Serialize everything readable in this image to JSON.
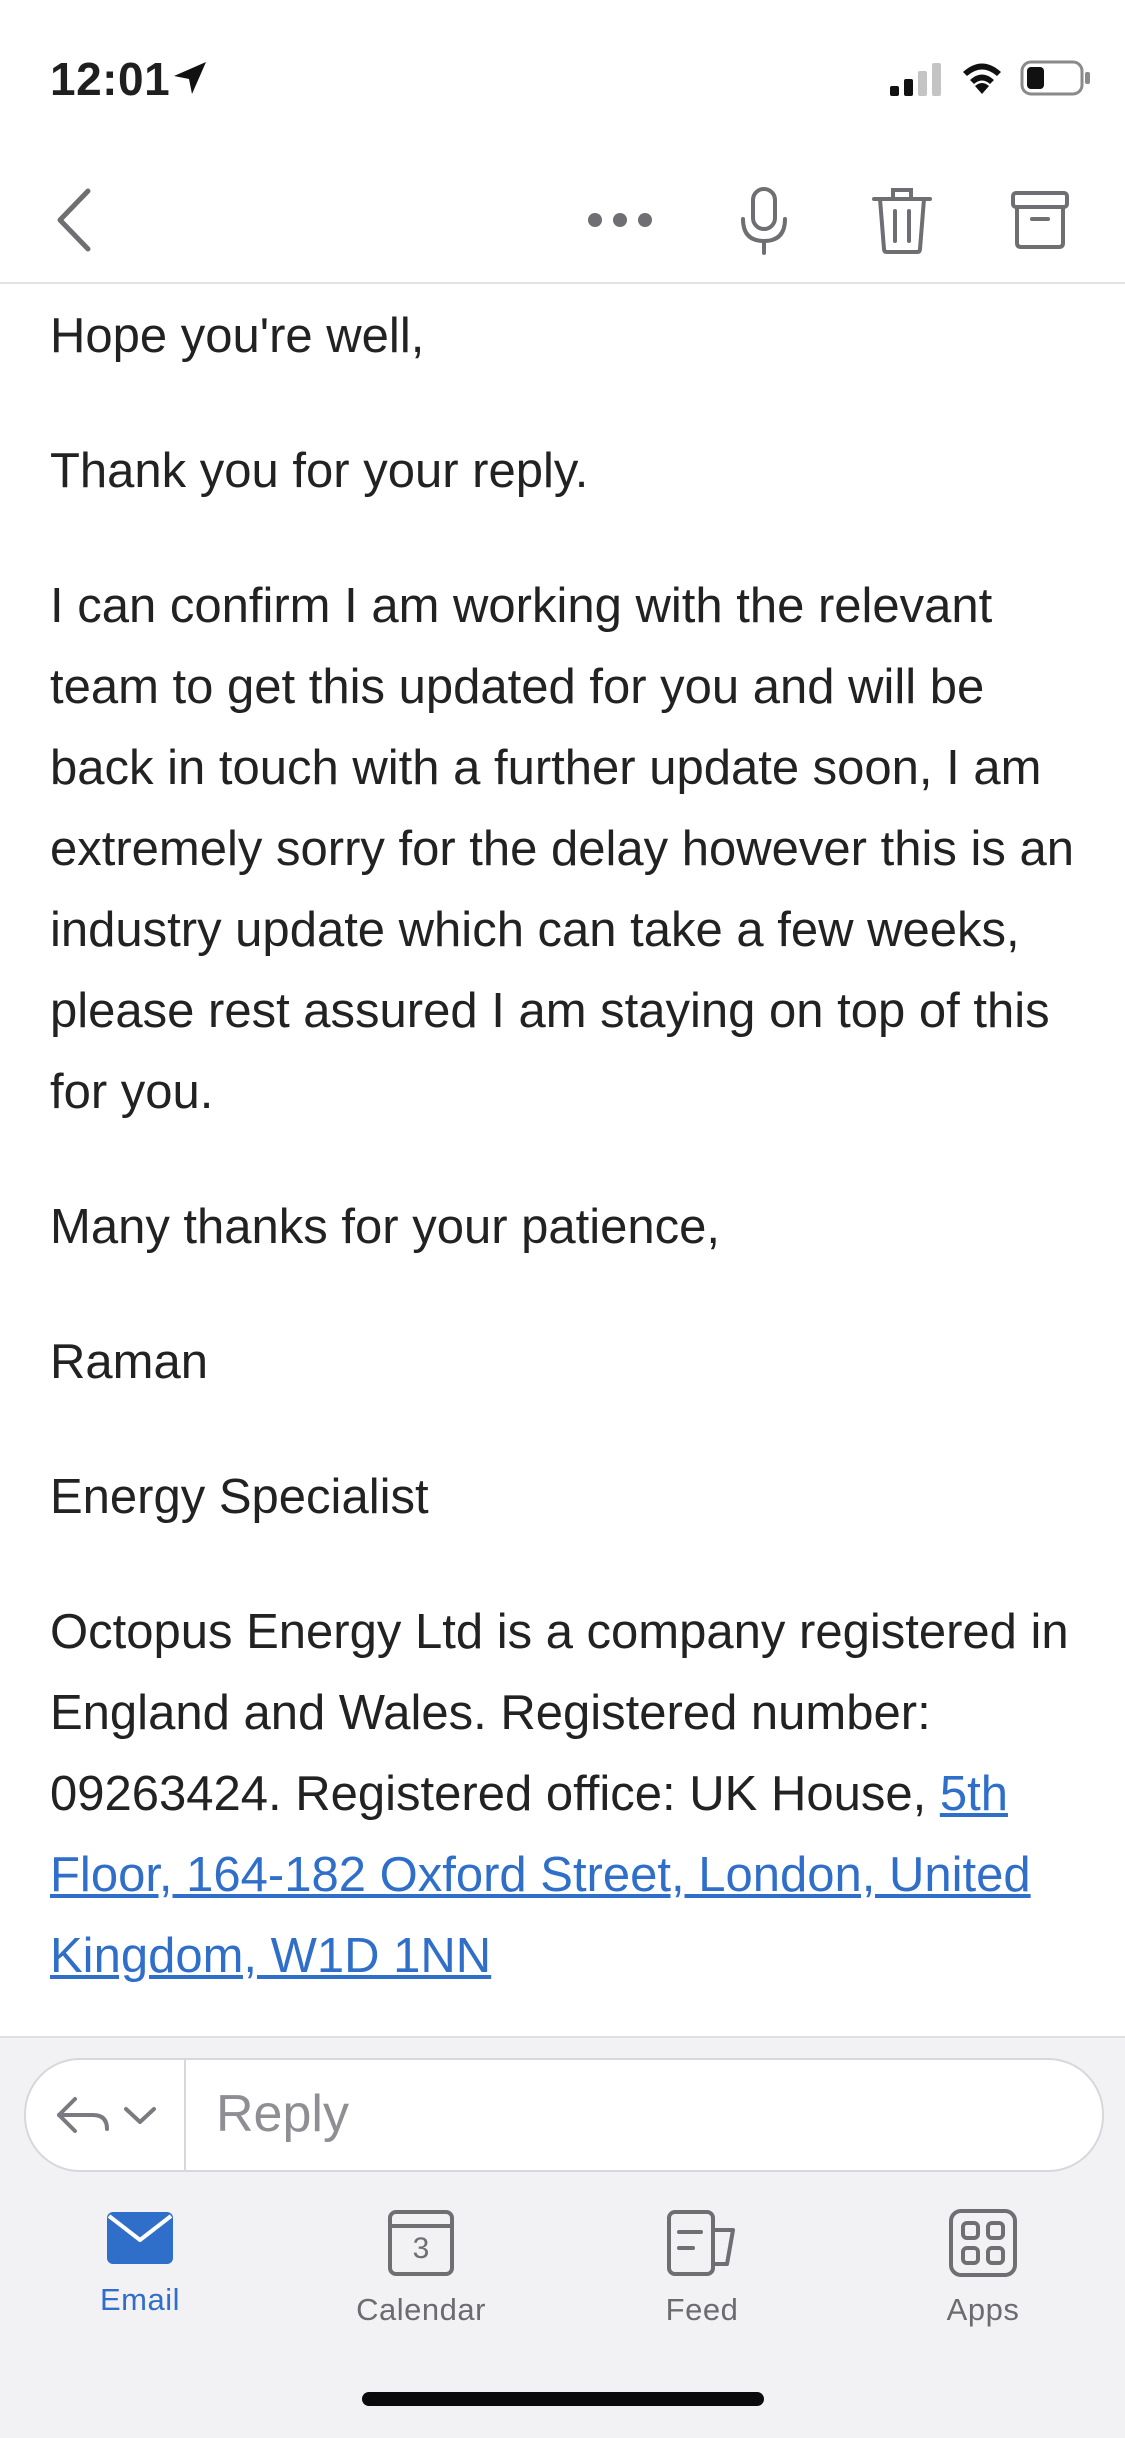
{
  "status_bar": {
    "time": "12:01"
  },
  "toolbar": {
    "icons": [
      "back-chevron-icon",
      "more-icon",
      "microphone-icon",
      "trash-icon",
      "archive-icon"
    ]
  },
  "message": {
    "paragraphs": [
      "Hope you're well,",
      "Thank you for your reply.",
      "I can confirm I am working with the relevant team to get this updated for you and will be back in touch with a further update soon, I am extremely sorry for the delay however this is an industry update which can take a few weeks, please rest assured I am staying on top of this for you.",
      "Many thanks for your patience,",
      "Raman",
      "Energy Specialist"
    ],
    "footer_text": "Octopus Energy Ltd is a company registered in England and Wales. Registered number: 09263424. Registered office: UK House, ",
    "footer_link": "5th Floor, 164-182 Oxford Street, London, United Kingdom, W1D 1NN"
  },
  "reply": {
    "placeholder": "Reply"
  },
  "tab_bar": {
    "tabs": [
      {
        "label": "Email",
        "active": true
      },
      {
        "label": "Calendar",
        "badge": "3"
      },
      {
        "label": "Feed"
      },
      {
        "label": "Apps"
      }
    ]
  },
  "colors": {
    "accent": "#2f6ec9",
    "icon_gray": "#7a7a80",
    "text": "#222222"
  }
}
